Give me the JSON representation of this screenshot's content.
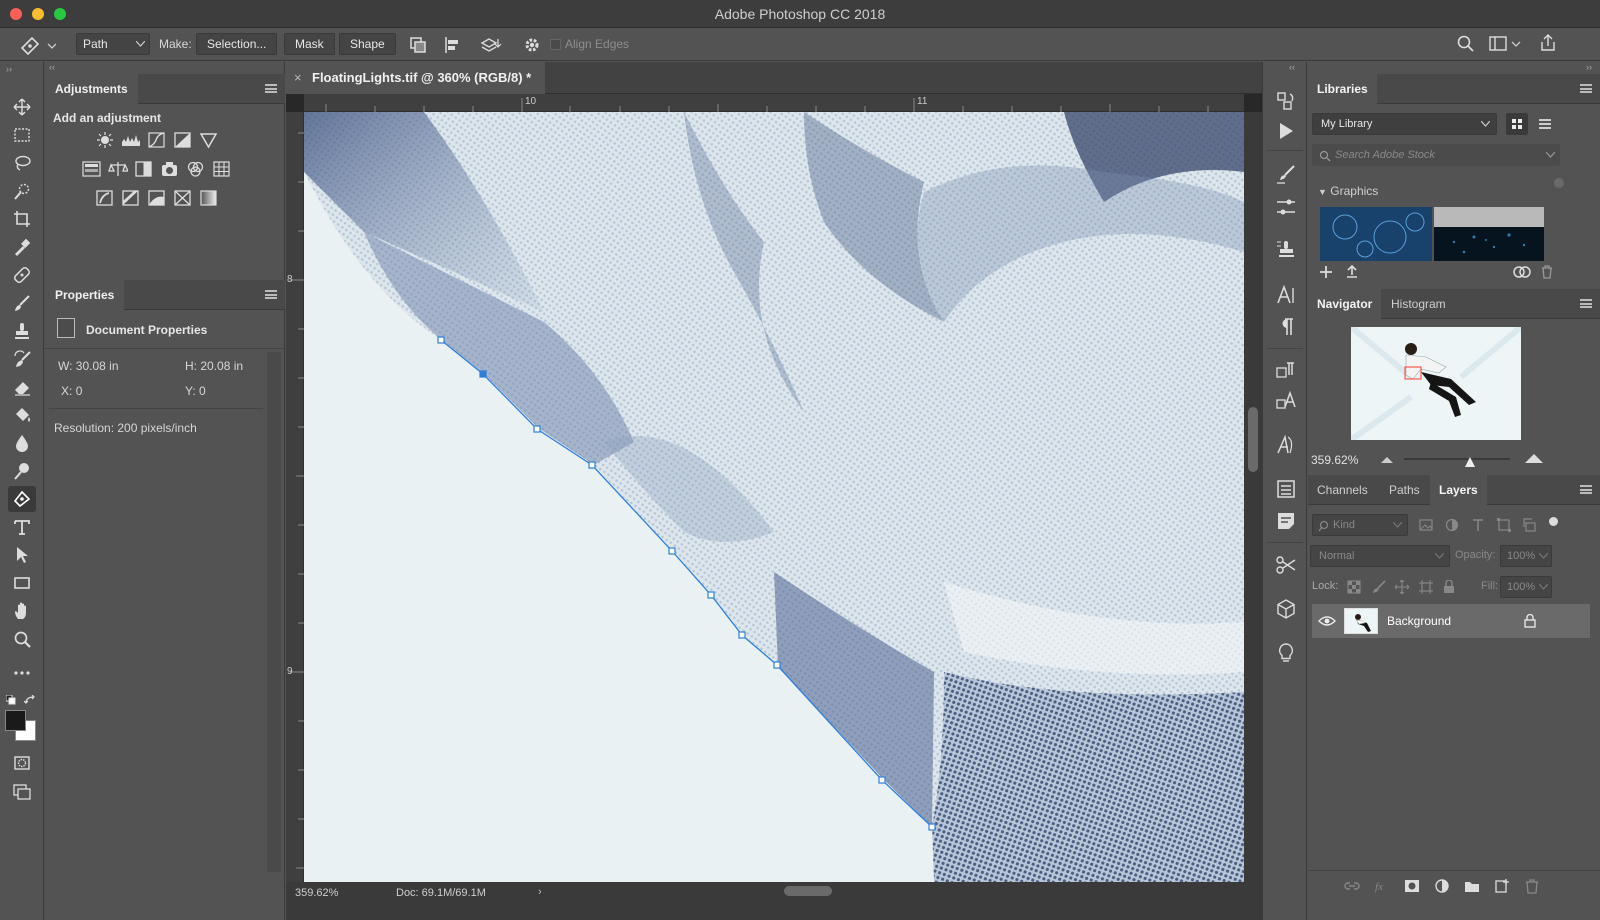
{
  "window": {
    "title": "Adobe Photoshop CC 2018",
    "traffic_colors": [
      "#fc5f57",
      "#fdbc2e",
      "#28c840"
    ]
  },
  "options_bar": {
    "mode_value": "Path",
    "make_label": "Make:",
    "selection_label": "Selection...",
    "mask_label": "Mask",
    "shape_label": "Shape",
    "align_edges_label": "Align Edges"
  },
  "adjustments": {
    "title": "Adjustments",
    "subtitle": "Add an adjustment"
  },
  "properties": {
    "title": "Properties",
    "doc_props_label": "Document Properties",
    "w_label": "W:",
    "w_value": "30.08 in",
    "h_label": "H:",
    "h_value": "20.08 in",
    "x_label": "X:",
    "x_value": "0",
    "y_label": "Y:",
    "y_value": "0",
    "resolution": "Resolution: 200 pixels/inch"
  },
  "document": {
    "tab_title": "FloatingLights.tif @ 360% (RGB/8) *",
    "ruler_h_labels": [
      "10",
      "11"
    ],
    "ruler_v_labels": [
      "8",
      "9"
    ],
    "zoom_status": "359.62%",
    "doc_status": "Doc: 69.1M/69.1M"
  },
  "libraries": {
    "title": "Libraries",
    "library_select": "My Library",
    "search_placeholder": "Search Adobe Stock",
    "graphics_label": "Graphics"
  },
  "navigator": {
    "tabs": [
      "Navigator",
      "Histogram"
    ],
    "zoom": "359.62%"
  },
  "layers_panel": {
    "tabs": [
      "Channels",
      "Paths",
      "Layers"
    ],
    "kind_placeholder": "Kind",
    "blend_mode": "Normal",
    "opacity_label": "Opacity:",
    "opacity_value": "100%",
    "lock_label": "Lock:",
    "fill_label": "Fill:",
    "fill_value": "100%",
    "layers": [
      {
        "name": "Background",
        "visible": true,
        "locked": true
      }
    ]
  },
  "colors": {
    "accent_path": "#2f7fd8",
    "foreground": "#1a1a1a",
    "background": "#ffffff"
  }
}
